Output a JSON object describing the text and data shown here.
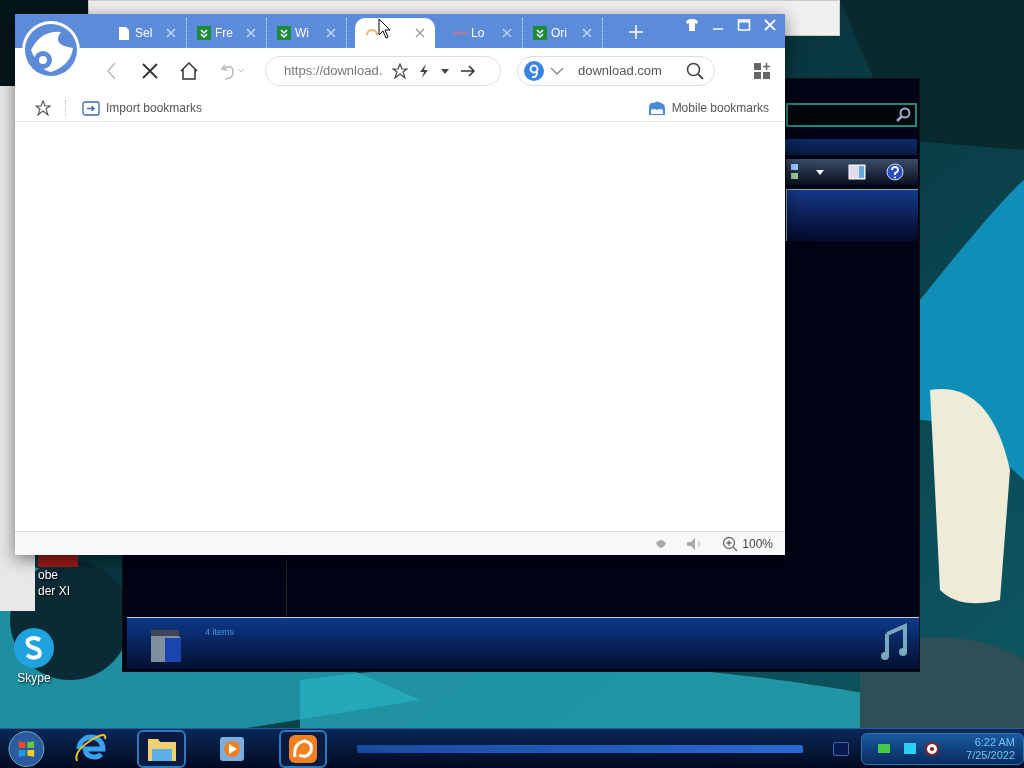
{
  "desktop": {
    "icons": [
      {
        "kind": "reader",
        "lines": [
          "obe",
          "der XI"
        ]
      },
      {
        "kind": "skype",
        "lines": [
          "Skype"
        ]
      }
    ]
  },
  "explorer": {
    "details": {
      "count": "4 items"
    }
  },
  "browser": {
    "tabs": [
      {
        "title": "Sel",
        "kind": "page",
        "selected": false
      },
      {
        "title": "Fre",
        "kind": "download",
        "selected": false
      },
      {
        "title": "Wi",
        "kind": "download",
        "selected": false
      },
      {
        "kind": "loading",
        "selected": true
      },
      {
        "title": "Lo",
        "kind": "faded",
        "selected": false
      },
      {
        "title": "Ori",
        "kind": "download",
        "selected": false
      }
    ],
    "address": "https://download.",
    "search": "download.com",
    "bookmarks": {
      "left": "Import bookmarks",
      "right": "Mobile bookmarks"
    },
    "status": {
      "zoom": "100%"
    }
  },
  "taskbar": {
    "items": [
      {
        "kind": "ie",
        "running": false
      },
      {
        "kind": "folder",
        "running": true
      },
      {
        "kind": "media",
        "running": false
      },
      {
        "kind": "uc",
        "running": true
      }
    ],
    "clock": {
      "time": "6:22 AM",
      "date": "7/25/2022"
    }
  }
}
